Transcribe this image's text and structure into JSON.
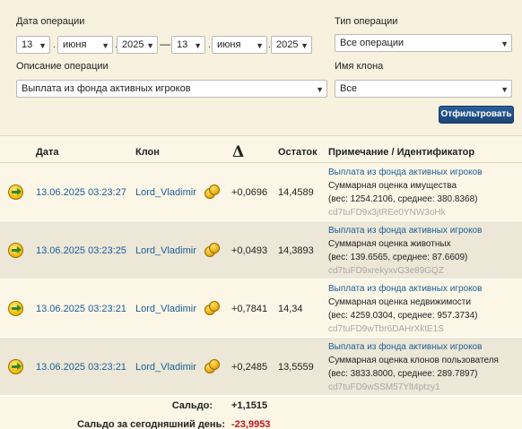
{
  "filter": {
    "date_label": "Дата операции",
    "type_label": "Тип операции",
    "desc_label": "Описание операции",
    "clone_label": "Имя клона",
    "date_from": {
      "day": "13",
      "month": "июня",
      "year": "2025"
    },
    "date_sep": "—",
    "date_to": {
      "day": "13",
      "month": "июня",
      "year": "2025"
    },
    "type_value": "Все операции",
    "desc_value": "Выплата из фонда активных игроков",
    "clone_value": "Все",
    "submit_label": "Отфильтровать"
  },
  "table": {
    "headers": {
      "date": "Дата",
      "clone": "Клон",
      "delta": "Δ",
      "balance": "Остаток",
      "note": "Примечание / Идентификатор"
    },
    "rows": [
      {
        "date": "13.06.2025 03:23:27",
        "clone": "Lord_Vladimir",
        "delta": "+0,0696",
        "balance": "14,4589",
        "note_title": "Выплата из фонда активных игроков",
        "note_line1": "Суммарная оценка имущества",
        "note_line2": "(вес: 1254.2106, среднее: 380.8368)",
        "note_id": "cd7tuFD9x3jtREe0YNW3oHk"
      },
      {
        "date": "13.06.2025 03:23:25",
        "clone": "Lord_Vladimir",
        "delta": "+0,0493",
        "balance": "14,3893",
        "note_title": "Выплата из фонда активных игроков",
        "note_line1": "Суммарная оценка животных",
        "note_line2": "(вес: 139.6565, среднее: 87.6609)",
        "note_id": "cd7tuFD9xrekyxvG3e89GQZ"
      },
      {
        "date": "13.06.2025 03:23:21",
        "clone": "Lord_Vladimir",
        "delta": "+0,7841",
        "balance": "14,34",
        "note_title": "Выплата из фонда активных игроков",
        "note_line1": "Суммарная оценка недвижимости",
        "note_line2": "(вес: 4259.0304, среднее: 957.3734)",
        "note_id": "cd7tuFD9wTbr6DAHrXktE1S"
      },
      {
        "date": "13.06.2025 03:23:21",
        "clone": "Lord_Vladimir",
        "delta": "+0,2485",
        "balance": "13,5559",
        "note_title": "Выплата из фонда активных игроков",
        "note_line1": "Суммарная оценка клонов пользователя",
        "note_line2": "(вес: 3833.8000, среднее: 289.7897)",
        "note_id": "cd7tuFD9wSSM57Ylt4ptzy1"
      }
    ]
  },
  "totals": {
    "saldo_label": "Сальдо:",
    "saldo_value": "+1,1515",
    "today_label": "Сальдо за сегодняшний день:",
    "today_value": "-23,9953"
  },
  "colors": {
    "link": "#1b5e9b",
    "positive": "#222222",
    "negative": "#c0141b",
    "button": "#1c4577",
    "row_alt": "#ece7d6"
  }
}
